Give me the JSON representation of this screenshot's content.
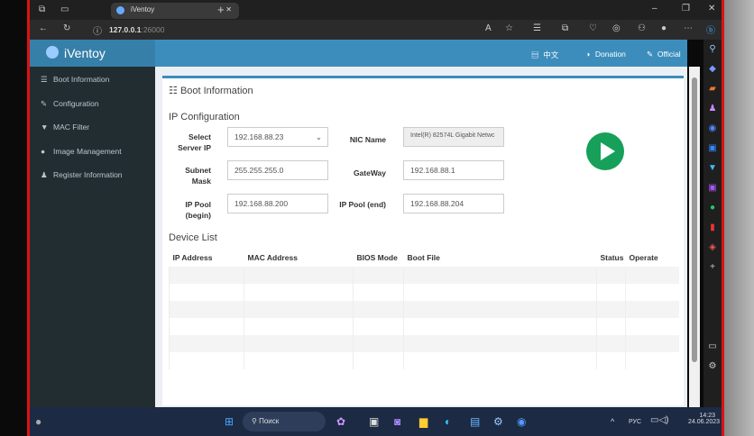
{
  "browser": {
    "tab_title": "iVentoy",
    "url_host": "127.0.0.1",
    "url_port": ":26000"
  },
  "app": {
    "name": "iVentoy",
    "lang": "中文",
    "donation": "Donation",
    "official": "Official"
  },
  "sidebar": {
    "items": [
      {
        "label": "Boot Information",
        "icon": "list-icon"
      },
      {
        "label": "Configuration",
        "icon": "wrench-icon"
      },
      {
        "label": "MAC Filter",
        "icon": "filter-icon"
      },
      {
        "label": "Image Management",
        "icon": "disc-icon"
      },
      {
        "label": "Register Information",
        "icon": "user-icon"
      }
    ]
  },
  "main": {
    "title": "Boot Information",
    "ip_config_title": "IP Configuration",
    "fields": {
      "server_ip_label": "Select Server IP",
      "server_ip": "192.168.88.23",
      "nic_label": "NIC Name",
      "nic": "Intel(R) 82574L Gigabit Netwc",
      "subnet_label": "Subnet Mask",
      "subnet": "255.255.255.0",
      "gateway_label": "GateWay",
      "gateway": "192.168.88.1",
      "pool_begin_label": "IP Pool (begin)",
      "pool_begin": "192.168.88.200",
      "pool_end_label": "IP Pool (end)",
      "pool_end": "192.168.88.204"
    },
    "device_list_title": "Device List",
    "columns": [
      "IP Address",
      "MAC Address",
      "BIOS Mode",
      "Boot File",
      "Status",
      "Operate"
    ]
  },
  "taskbar": {
    "search": "Поиск",
    "lang": "РУС",
    "time": "14:23",
    "date": "24.06.2023"
  },
  "colors": {
    "accent": "#3c8dbc",
    "sidebar": "#222d32",
    "play": "#16a05a"
  }
}
